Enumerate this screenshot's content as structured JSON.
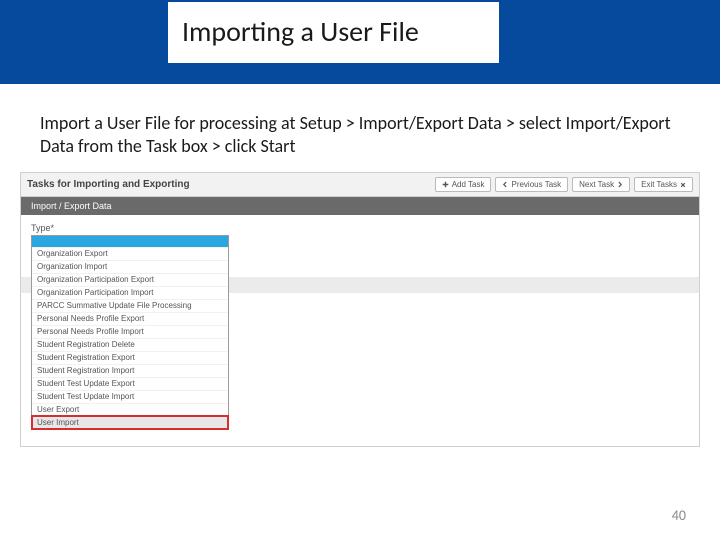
{
  "slide": {
    "title": "Importing a User File",
    "instruction": "Import a User File for processing at Setup > Import/Export Data > select Import/Export Data from the Task box > click Start",
    "page_number": "40"
  },
  "mock": {
    "panel_title": "Tasks for Importing and Exporting",
    "buttons": {
      "add": "Add Task",
      "prev": "Previous Task",
      "next": "Next Task",
      "exit": "Exit Tasks"
    },
    "tab": "Import / Export Data",
    "type_label": "Type*",
    "options": [
      "Organization Export",
      "Organization Import",
      "Organization Participation Export",
      "Organization Participation Import",
      "PARCC Summative Update File Processing",
      "Personal Needs Profile Export",
      "Personal Needs Profile Import",
      "Student Registration Delete",
      "Student Registration Export",
      "Student Registration Import",
      "Student Test Update Export",
      "Student Test Update Import",
      "User Export"
    ],
    "highlighted_option": "User Import"
  }
}
